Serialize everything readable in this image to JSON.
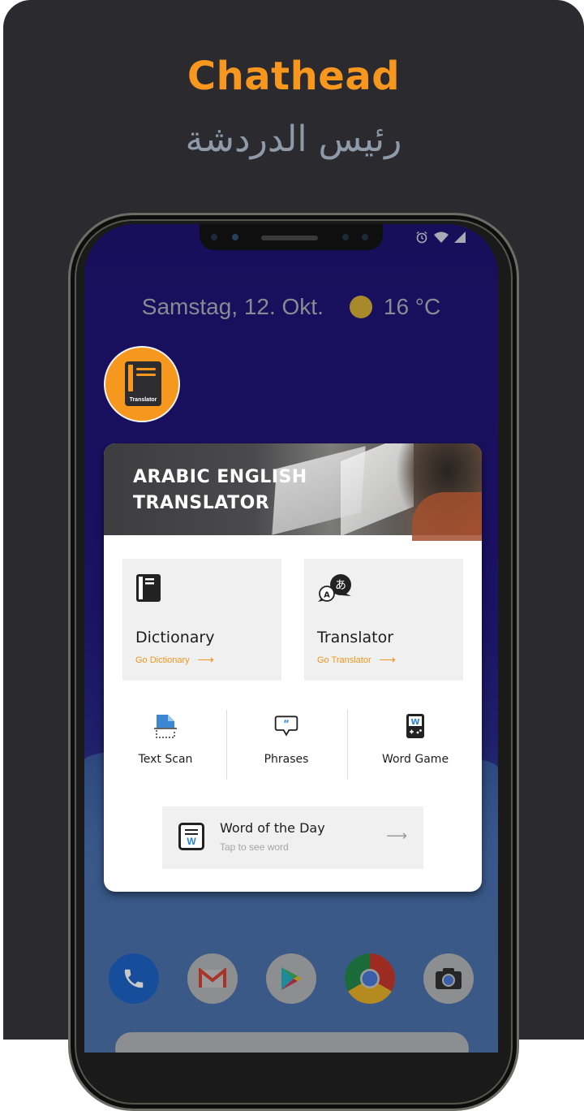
{
  "promo": {
    "title": "Chathead",
    "subtitle_arabic": "رئيس الدردشة"
  },
  "colors": {
    "accent": "#f7971e",
    "background": "#2b2a2f",
    "wallpaper": "#1a1262",
    "scan_blue": "#2b83d6"
  },
  "status_bar": {
    "icons": [
      "alarm-icon",
      "wifi-icon",
      "cell-signal-icon"
    ]
  },
  "lock_widget": {
    "date": "Samstag, 12. Okt.",
    "weather_icon": "sun-icon",
    "temperature": "16 °C"
  },
  "chathead": {
    "label": "Translator"
  },
  "card": {
    "banner_title_line1": "ARABIC ENGLISH",
    "banner_title_line2": "TRANSLATOR",
    "tiles": [
      {
        "icon": "book-icon",
        "title": "Dictionary",
        "link": "Go Dictionary",
        "arrow": "⟶"
      },
      {
        "icon": "translate-bubbles-icon",
        "title": "Translator",
        "link": "Go Translator",
        "arrow": "⟶"
      }
    ],
    "features": [
      {
        "icon": "text-scan-icon",
        "label": "Text Scan"
      },
      {
        "icon": "quote-bubble-icon",
        "label": "Phrases"
      },
      {
        "icon": "handheld-game-icon",
        "label": "Word Game"
      }
    ],
    "word_of_day": {
      "icon_letter": "W",
      "title": "Word of the Day",
      "subtitle": "Tap to see word",
      "arrow": "⟶"
    }
  },
  "translate_icon_letters": {
    "small": "A",
    "large": "あ"
  },
  "dock": {
    "apps": [
      "Phone",
      "Gmail",
      "Play Store",
      "Chrome",
      "Camera"
    ]
  }
}
